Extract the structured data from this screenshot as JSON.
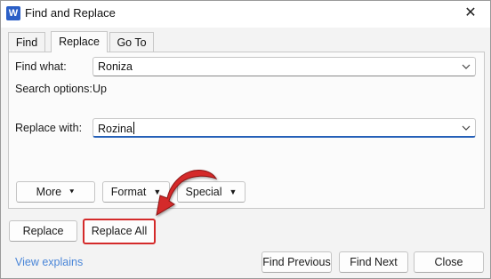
{
  "window": {
    "title": "Find and Replace",
    "app_icon_letter": "W",
    "close_glyph": "✕"
  },
  "tabs": [
    {
      "label": "Find",
      "active": false
    },
    {
      "label": "Replace",
      "active": true
    },
    {
      "label": "Go To",
      "active": false
    }
  ],
  "find": {
    "label": "Find what:",
    "value": "Roniza"
  },
  "search_options": {
    "label": "Search options:",
    "value": "Up"
  },
  "replace": {
    "label": "Replace with:",
    "value": "Rozina"
  },
  "option_buttons": {
    "more": "More",
    "more_glyph": "⯆",
    "format": "Format",
    "special": "Special",
    "dropdown_glyph": "▼"
  },
  "action_buttons": {
    "replace": "Replace",
    "replace_all": "Replace All",
    "find_previous": "Find Previous",
    "find_next": "Find Next",
    "close": "Close"
  },
  "footer_link": "View explains",
  "colors": {
    "highlight_red": "#d42a2a",
    "link_blue": "#4a86d8",
    "word_blue": "#2b5fc7"
  },
  "icons": [
    "word-app-icon",
    "close-icon",
    "chevron-down-icon",
    "annotation-arrow-icon"
  ]
}
